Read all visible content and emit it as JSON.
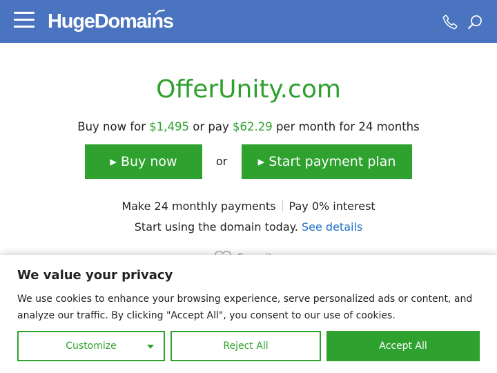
{
  "header": {
    "logo_text": "HugeDomains",
    "bg_color": "#4a74bf",
    "menu_icon": "hamburger-menu-icon",
    "phone_icon": "phone-icon",
    "search_icon": "search-icon"
  },
  "domain": {
    "name": "OfferUnity.com",
    "price_prefix": "Buy now for ",
    "price": "$1,495",
    "price_middle": " or pay ",
    "monthly": "$62.29",
    "price_suffix": " per month for 24 months"
  },
  "actions": {
    "buy_label": "▸ Buy now",
    "or_label": "or",
    "plan_label": "▸ Start payment plan"
  },
  "info": {
    "payments": "Make 24 monthly payments",
    "interest": "Pay 0% interest",
    "start_text": "Start using the domain today. ",
    "details_link": "See details"
  },
  "favorite": {
    "icon": "heart-icon",
    "label": "Favorite"
  },
  "cookie": {
    "title": "We value your privacy",
    "text": "We use cookies to enhance your browsing experience, serve personalized ads or content, and analyze our traffic. By clicking \"Accept All\", you consent to our use of cookies.",
    "customize_label": "Customize",
    "reject_label": "Reject All",
    "accept_label": "Accept All"
  },
  "colors": {
    "accent_green": "#2ea12e",
    "link_blue": "#1a6fc9"
  }
}
